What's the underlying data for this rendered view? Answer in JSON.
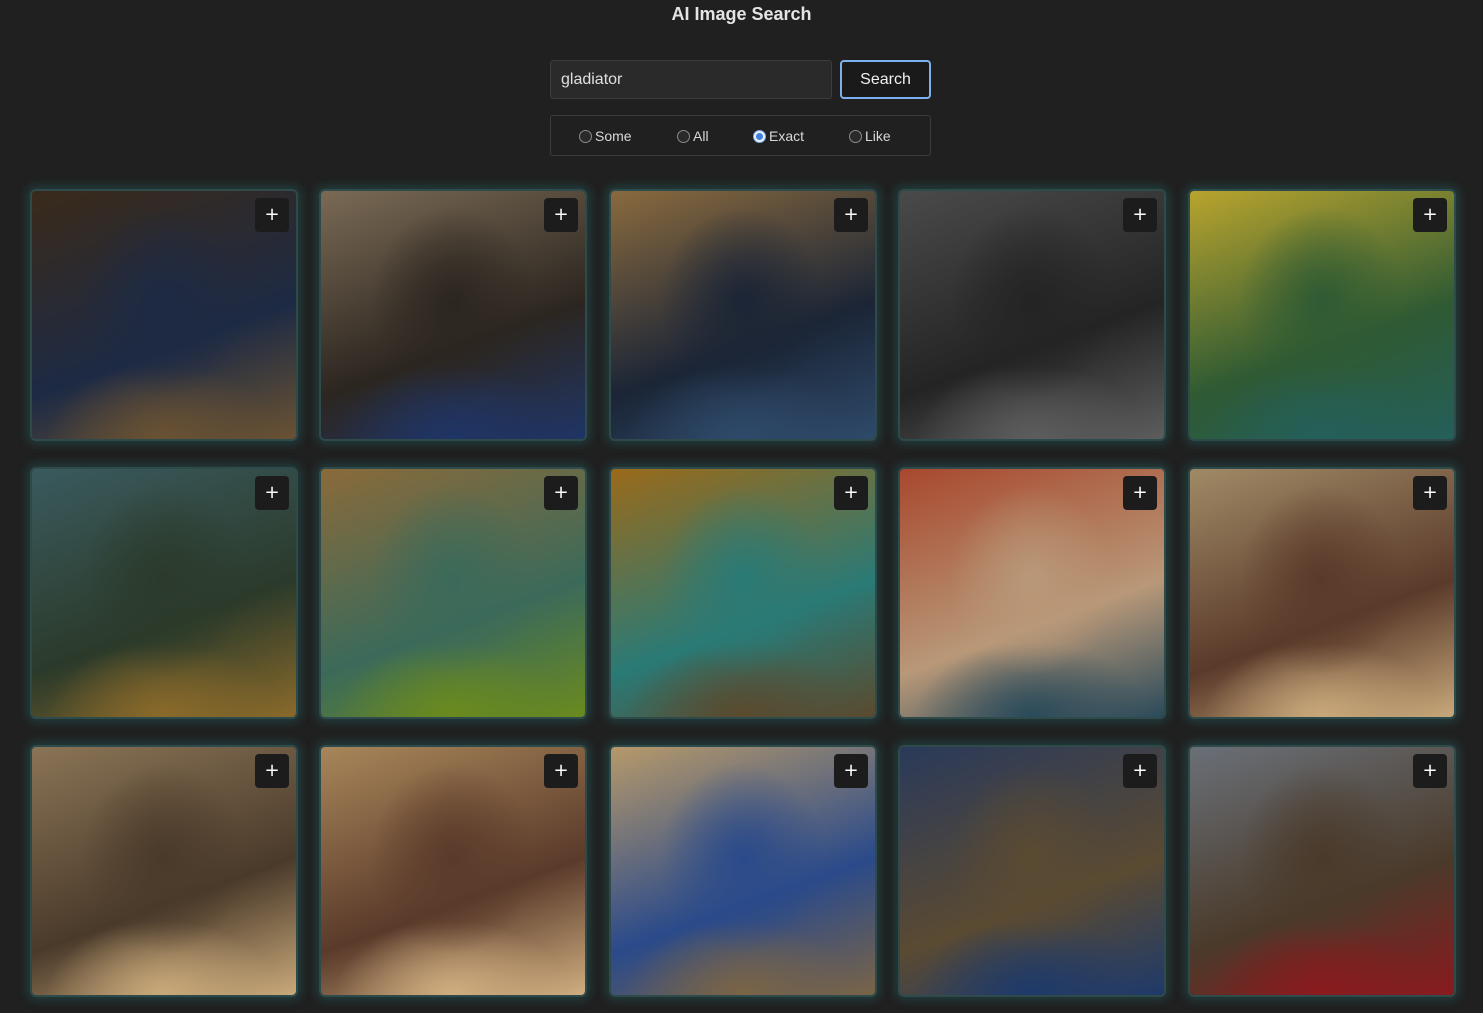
{
  "app": {
    "title": "AI Image Search"
  },
  "search": {
    "value": "gladiator",
    "button_label": "Search"
  },
  "modes": [
    {
      "label": "Some",
      "checked": false
    },
    {
      "label": "All",
      "checked": false
    },
    {
      "label": "Exact",
      "checked": true
    },
    {
      "label": "Like",
      "checked": false
    }
  ],
  "add_label": "+",
  "results": [
    {
      "subject": "curly-haired man in blue cape and leather armor",
      "colors": [
        "#3a2a1a",
        "#1d2a44",
        "#6a5232"
      ]
    },
    {
      "subject": "man in leather chest armor with blue cape",
      "colors": [
        "#7a6a55",
        "#2c2620",
        "#1f3566"
      ]
    },
    {
      "subject": "warrior in blue armor with black cape",
      "colors": [
        "#8a6a3e",
        "#1b2536",
        "#2e4a6a"
      ]
    },
    {
      "subject": "man in dark plate armor, grey background",
      "colors": [
        "#4a4a4a",
        "#242424",
        "#5d5d5d"
      ]
    },
    {
      "subject": "teal warrior statue in autumn forest",
      "colors": [
        "#b9a42e",
        "#2f5a33",
        "#245f5a"
      ]
    },
    {
      "subject": "equestrian statue among trees",
      "colors": [
        "#3a5a5e",
        "#2b3a2a",
        "#8a6a2a"
      ]
    },
    {
      "subject": "teal statue on mossy stone pedestal",
      "colors": [
        "#8a6a3a",
        "#3b6a5a",
        "#6a8a1e"
      ]
    },
    {
      "subject": "teal warrior statue, autumn forest",
      "colors": [
        "#9a6a1a",
        "#2a7a76",
        "#5a4a2e"
      ]
    },
    {
      "subject": "two female gladiators fighting in arena",
      "colors": [
        "#a8482e",
        "#b89878",
        "#2a4a5a"
      ]
    },
    {
      "subject": "female gladiators wrestling in sand",
      "colors": [
        "#a08a66",
        "#5a3a2a",
        "#c8a87a"
      ]
    },
    {
      "subject": "female gladiators fighting in dust",
      "colors": [
        "#8a7456",
        "#4a3a2a",
        "#c9a97a"
      ]
    },
    {
      "subject": "female gladiators clashing in arena",
      "colors": [
        "#a8865a",
        "#5a3a2a",
        "#cfae80"
      ]
    },
    {
      "subject": "gladiator in blue skirt with sword",
      "colors": [
        "#b6996a",
        "#2a4a8a",
        "#7a6446"
      ]
    },
    {
      "subject": "bearded warrior with blue scarf",
      "colors": [
        "#2a3a5a",
        "#5a4a32",
        "#1e3a6a"
      ]
    },
    {
      "subject": "man in bronze armor with red cape",
      "colors": [
        "#6a7078",
        "#4a3a2a",
        "#8a1a1e"
      ]
    }
  ]
}
